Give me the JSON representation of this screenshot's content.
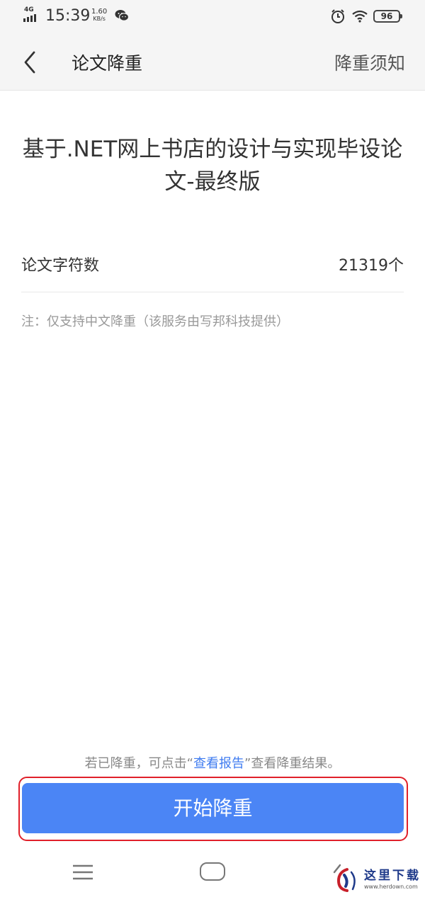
{
  "status_bar": {
    "network": "4G",
    "time": "15:39",
    "speed_value": "1.60",
    "speed_unit": "KB/s",
    "battery": "96"
  },
  "header": {
    "title": "论文降重",
    "right_link": "降重须知"
  },
  "document": {
    "title": "基于.NET网上书店的设计与实现毕设论文-最终版"
  },
  "info_row": {
    "label": "论文字符数",
    "value": "21319个"
  },
  "note": "注：仅支持中文降重（该服务由写邦科技提供）",
  "hint": {
    "prefix": "若已降重，可点击“",
    "link": "查看报告",
    "suffix": "”查看降重结果。"
  },
  "start_button": {
    "label": "开始降重"
  },
  "watermark": {
    "text": "这里下载",
    "url": "www.herdown.com"
  },
  "colors": {
    "primary": "#4b85f5",
    "link": "#3e7bf0",
    "highlight_frame": "#e0202a",
    "header_bg": "#f5f5f5"
  }
}
